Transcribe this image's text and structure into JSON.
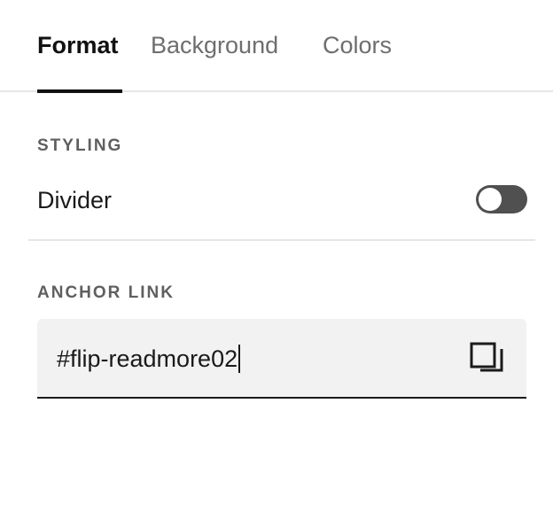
{
  "tabs": [
    {
      "label": "Format",
      "active": true
    },
    {
      "label": "Background",
      "active": false
    },
    {
      "label": "Colors",
      "active": false
    }
  ],
  "styling": {
    "section_label": "STYLING",
    "divider_label": "Divider",
    "divider_enabled": false
  },
  "anchor": {
    "section_label": "ANCHOR LINK",
    "value": "#flip-readmore02",
    "copy_icon": "copy-icon"
  },
  "colors": {
    "active_text": "#111111",
    "inactive_text": "#6e6e6e",
    "toggle_off": "#505050",
    "field_bg": "#f2f2f2"
  }
}
